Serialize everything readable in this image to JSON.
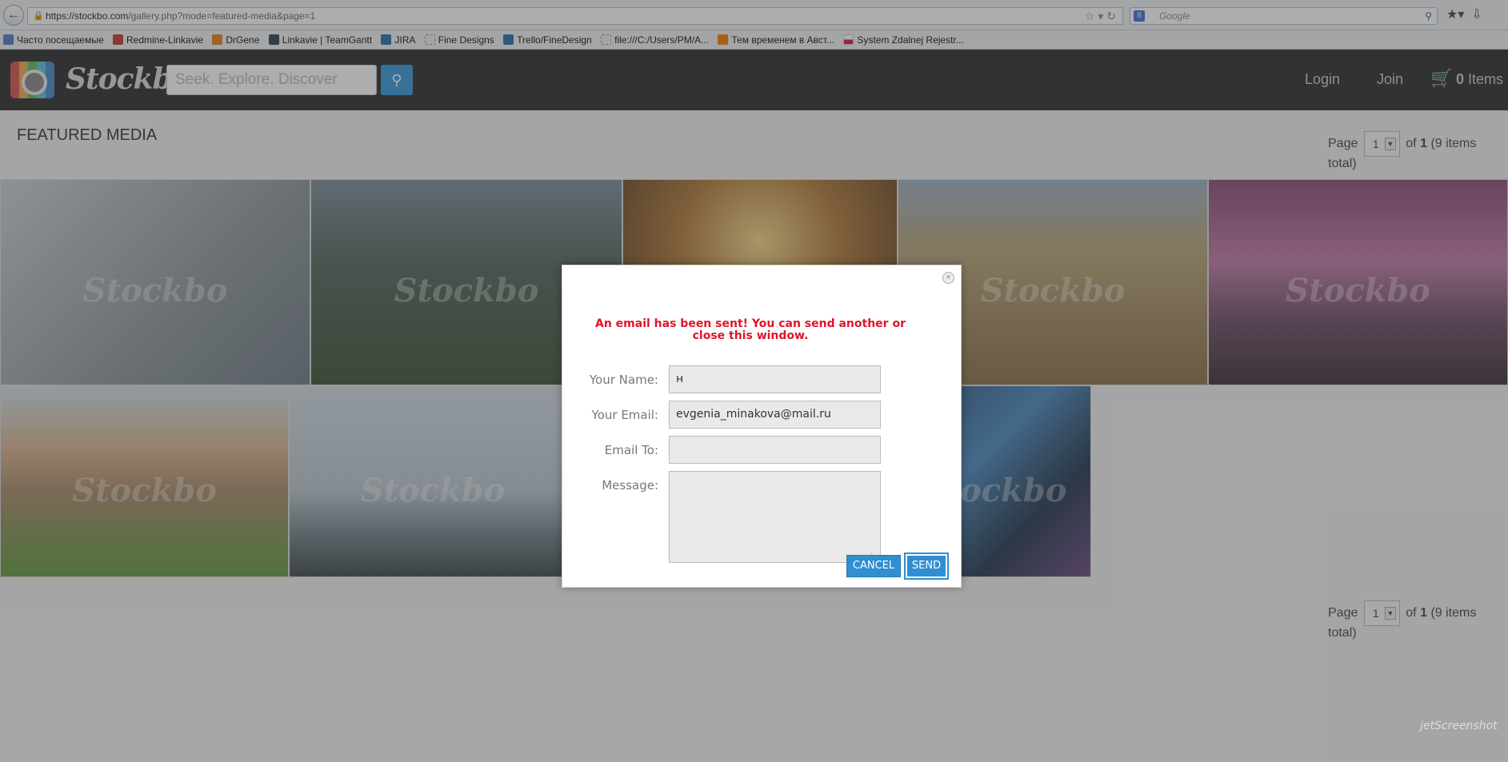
{
  "browser": {
    "url_host": "https://stockbo.com",
    "url_path": "/gallery.php?mode=featured-media&page=1",
    "search_placeholder": "Google",
    "bookmarks": [
      {
        "label": "Часто посещаемые",
        "color": "#4a7dc8"
      },
      {
        "label": "Redmine-Linkavie",
        "color": "#c0392b"
      },
      {
        "label": "DrGene",
        "color": "#e67e22"
      },
      {
        "label": "Linkavie | TeamGantt",
        "color": "#2c3e50"
      },
      {
        "label": "JIRA",
        "color": "#1f6fb2"
      },
      {
        "label": "Fine Designs",
        "color": "#bbbbbb"
      },
      {
        "label": "Trello/FineDesign",
        "color": "#1f6fb2"
      },
      {
        "label": "file:///C:/Users/PM/A...",
        "color": "#bbbbbb"
      },
      {
        "label": "Тем временем в Авст...",
        "color": "#f57c00"
      },
      {
        "label": "System Zdalnej Rejestr...",
        "color": "#dc143c"
      }
    ]
  },
  "site": {
    "logo_text": "Stockbo",
    "search_placeholder": "Seek. Explore. Discover",
    "nav": {
      "login": "Login",
      "join": "Join"
    },
    "cart": {
      "count": "0",
      "label": "Items"
    },
    "page_title": "FEATURED MEDIA",
    "pager": {
      "prefix": "Page",
      "current": "1",
      "of": "of",
      "total_pages": "1",
      "summary": "(9 items total)"
    },
    "watermark": "Stockbo",
    "gallery": [
      {
        "alt": "ballerina",
        "color": "#9aa3a8"
      },
      {
        "alt": "mountain valley",
        "color": "#4a5a46"
      },
      {
        "alt": "sunburst sky",
        "color": "#7a5a2a"
      },
      {
        "alt": "giraffe savanna",
        "color": "#8a7a55"
      },
      {
        "alt": "pink sunset coast",
        "color": "#8a5a78"
      },
      {
        "alt": "smiling child",
        "color": "#6a8a58"
      },
      {
        "alt": "woman on rocks",
        "color": "#8a98a6"
      },
      {
        "alt": "hidden tile",
        "color": "#556070"
      },
      {
        "alt": "abstract blue paint",
        "color": "#2f5f8a"
      }
    ]
  },
  "modal": {
    "message": "An email has been sent! You can send another or close this window.",
    "fields": {
      "name_label": "Your Name:",
      "name_value": "н",
      "email_label": "Your Email:",
      "email_value": "evgenia_minakova@mail.ru",
      "to_label": "Email To:",
      "to_value": "",
      "message_label": "Message:",
      "message_value": ""
    },
    "cancel_label": "CANCEL",
    "send_label": "SEND"
  },
  "watermark_app": "jetScreenshot"
}
